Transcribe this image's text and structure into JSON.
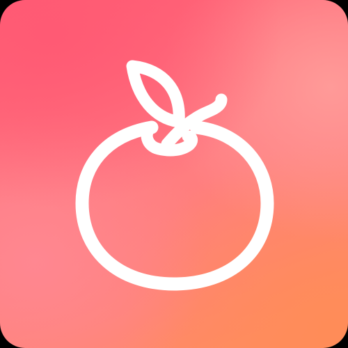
{
  "icon": "apple-app-icon",
  "glyph": "apple-fruit-icon",
  "colors": {
    "gradient_top_left": "#ff5a74",
    "gradient_bottom_right": "#ff8c58",
    "glyph_stroke": "#ffffff",
    "outer_background": "#000000"
  }
}
